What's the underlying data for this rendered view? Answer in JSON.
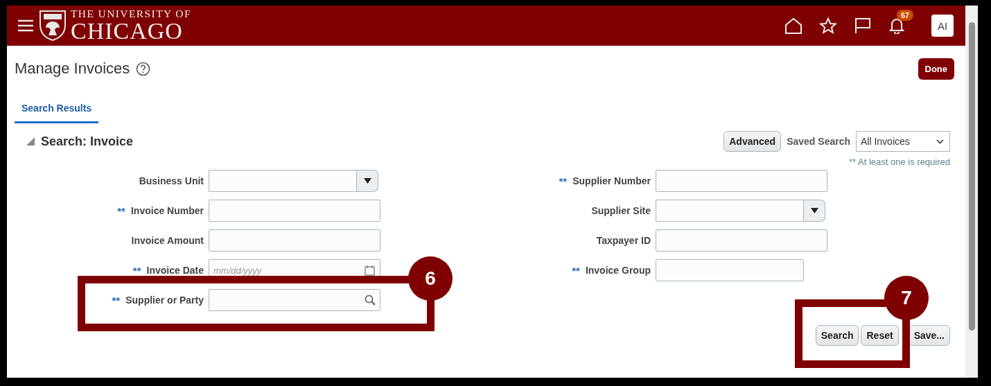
{
  "header": {
    "logo_line1": "THE UNIVERSITY OF",
    "logo_line2": "CHICAGO",
    "notifications": "67",
    "avatar": "AI"
  },
  "page": {
    "title": "Manage Invoices",
    "done_button": "Done"
  },
  "tabs": [
    {
      "label": "Search Results",
      "selected": true
    }
  ],
  "search": {
    "title": "Search: Invoice",
    "expanded": true,
    "advanced_button": "Advanced",
    "saved_search_label": "Saved Search",
    "saved_search_value": "All Invoices",
    "required_note": "** At least one is required",
    "left_fields": [
      {
        "label": "Business Unit",
        "kind": "select"
      },
      {
        "required_mark": "**",
        "label": "Invoice Number",
        "kind": "text"
      },
      {
        "label": "Invoice Amount",
        "kind": "text"
      },
      {
        "required_mark": "**",
        "label": "Invoice Date",
        "kind": "date",
        "placeholder": "mm/dd/yyyy"
      },
      {
        "required_mark": "**",
        "label": "Supplier or Party",
        "kind": "lookup"
      }
    ],
    "right_fields": [
      {
        "required_mark": "**",
        "label": "Supplier Number",
        "kind": "text"
      },
      {
        "label": "Supplier Site",
        "kind": "select"
      },
      {
        "label": "Taxpayer ID",
        "kind": "text"
      },
      {
        "required_mark": "**",
        "label": "Invoice Group",
        "kind": "short"
      }
    ],
    "buttons": [
      "Search",
      "Reset",
      "Save..."
    ]
  },
  "annotations": [
    {
      "number": "6"
    },
    {
      "number": "7"
    }
  ]
}
